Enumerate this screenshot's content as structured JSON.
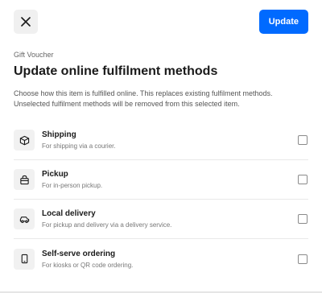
{
  "header": {
    "close_icon": "close-icon",
    "update_label": "Update",
    "accent_color": "#006aff"
  },
  "eyebrow": "Gift Voucher",
  "title": "Update online fulfilment methods",
  "description": "Choose how this item is fulfilled online. This replaces existing fulfilment methods. Unselected fulfilment methods will be removed from this selected item.",
  "options": [
    {
      "icon": "box-icon",
      "title": "Shipping",
      "subtitle": "For shipping via a courier.",
      "checked": false
    },
    {
      "icon": "bag-icon",
      "title": "Pickup",
      "subtitle": "For in-person pickup.",
      "checked": false
    },
    {
      "icon": "car-icon",
      "title": "Local delivery",
      "subtitle": "For pickup and delivery via a delivery service.",
      "checked": false
    },
    {
      "icon": "phone-icon",
      "title": "Self-serve ordering",
      "subtitle": "For kiosks or QR code ordering.",
      "checked": false
    }
  ]
}
